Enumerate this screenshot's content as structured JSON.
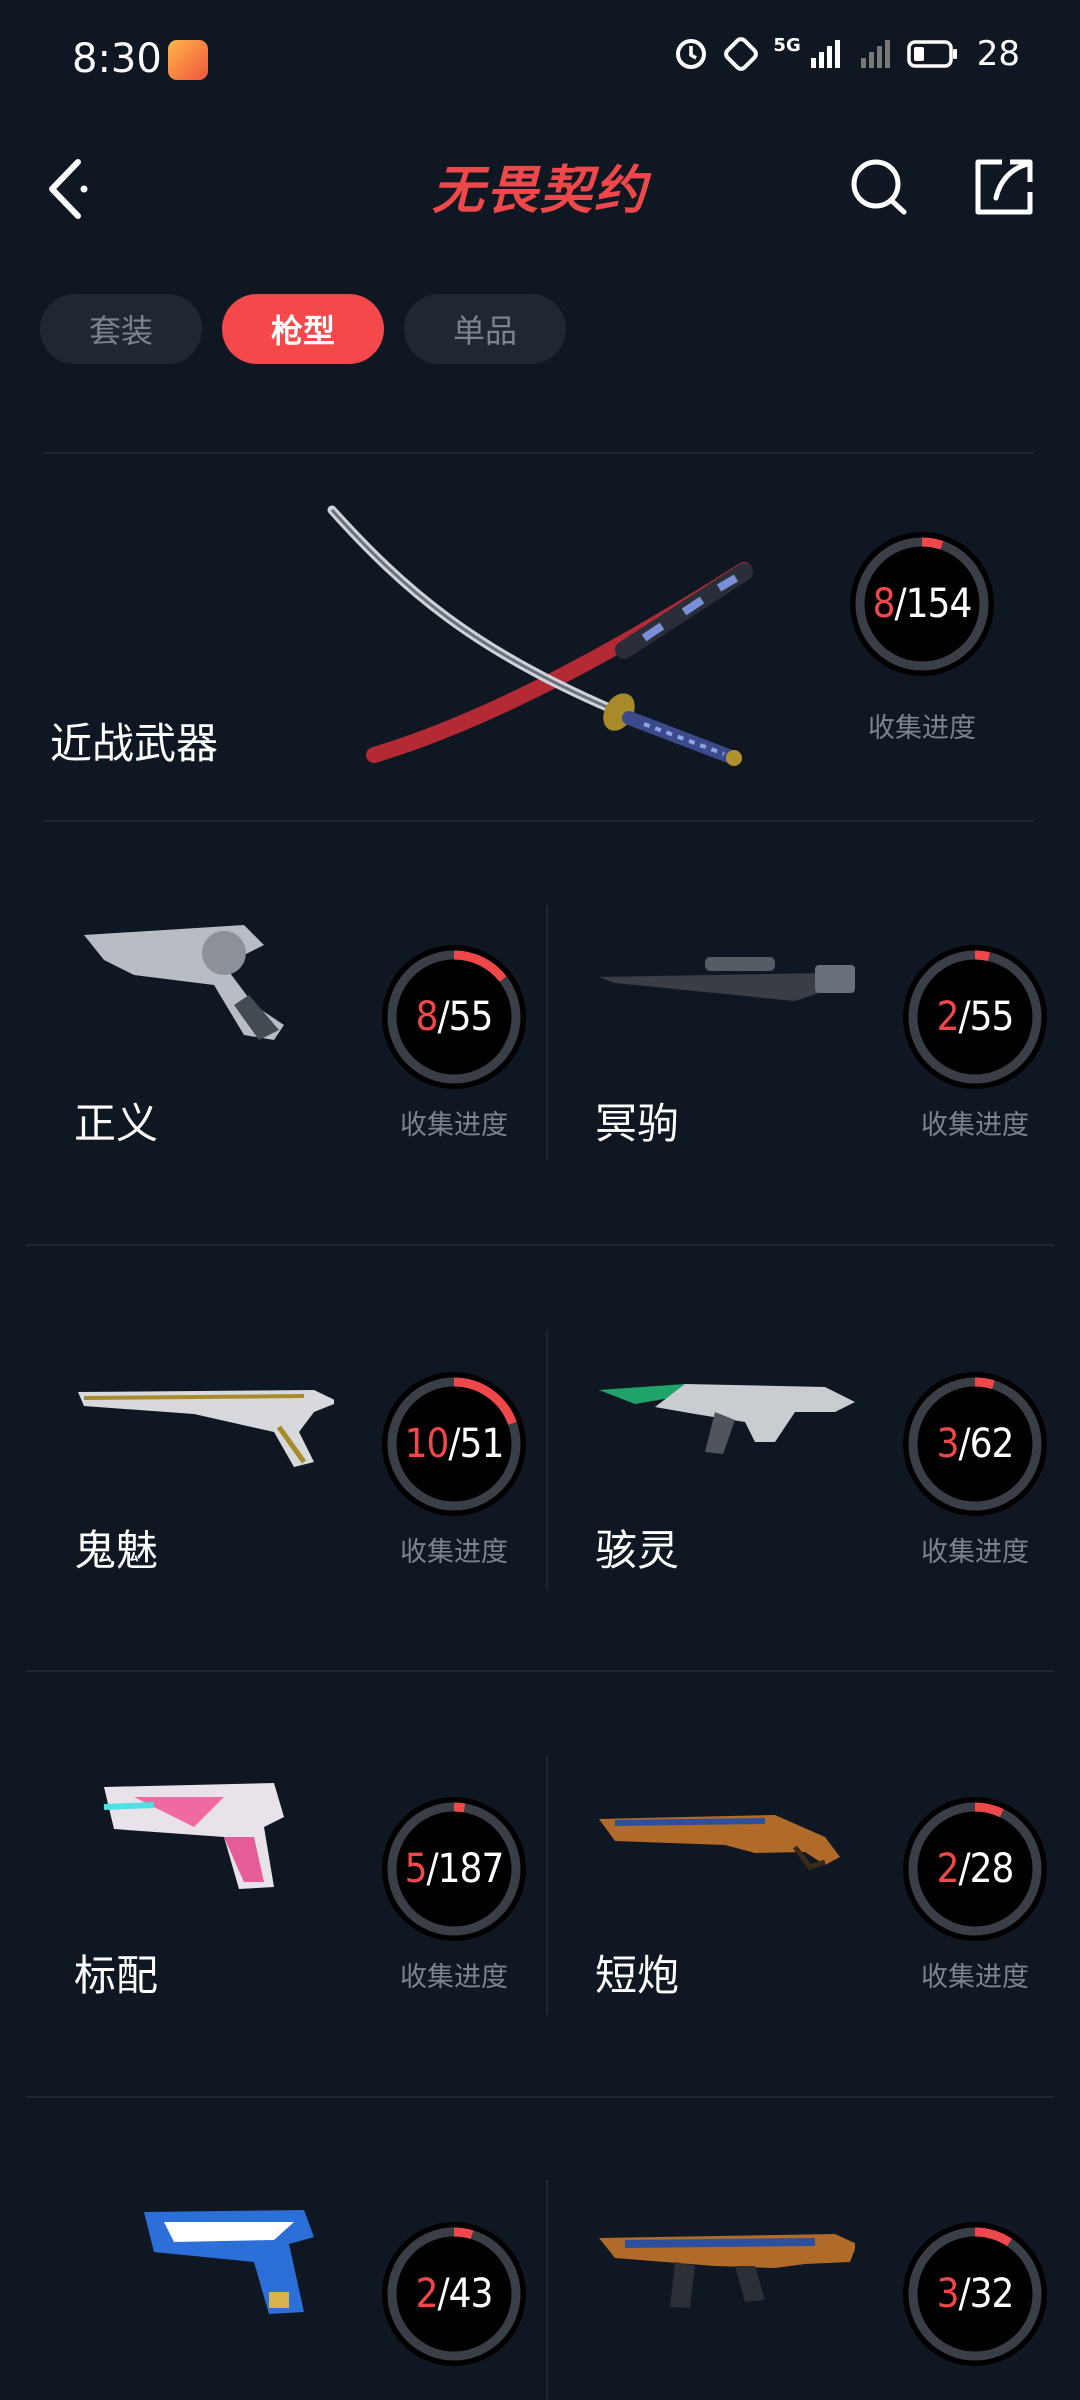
{
  "status_bar": {
    "time": "8:30",
    "network": "5G",
    "battery": "28"
  },
  "header": {
    "logo_text": "无畏契约"
  },
  "tabs": [
    {
      "label": "套装",
      "active": false
    },
    {
      "label": "枪型",
      "active": true
    },
    {
      "label": "单品",
      "active": false
    }
  ],
  "melee": {
    "name": "近战武器",
    "collected": "8",
    "total": "/154",
    "progress": 0.052,
    "progress_label": "收集进度"
  },
  "weapons": [
    {
      "name": "正义",
      "collected": "8",
      "total": "/55",
      "progress": 0.145,
      "progress_label": "收集进度"
    },
    {
      "name": "冥驹",
      "collected": "2",
      "total": "/55",
      "progress": 0.036,
      "progress_label": "收集进度"
    },
    {
      "name": "鬼魅",
      "collected": "10",
      "total": "/51",
      "progress": 0.196,
      "progress_label": "收集进度"
    },
    {
      "name": "骇灵",
      "collected": "3",
      "total": "/62",
      "progress": 0.048,
      "progress_label": "收集进度"
    },
    {
      "name": "标配",
      "collected": "5",
      "total": "/187",
      "progress": 0.027,
      "progress_label": "收集进度"
    },
    {
      "name": "短炮",
      "collected": "2",
      "total": "/28",
      "progress": 0.071,
      "progress_label": "收集进度"
    },
    {
      "name": "",
      "collected": "2",
      "total": "/43",
      "progress": 0.047,
      "progress_label": ""
    },
    {
      "name": "",
      "collected": "3",
      "total": "/32",
      "progress": 0.094,
      "progress_label": ""
    }
  ],
  "colors": {
    "background": "#0f1822",
    "accent": "#f0474a",
    "ring_track": "#3a3f47",
    "muted_text": "#7c838c"
  }
}
